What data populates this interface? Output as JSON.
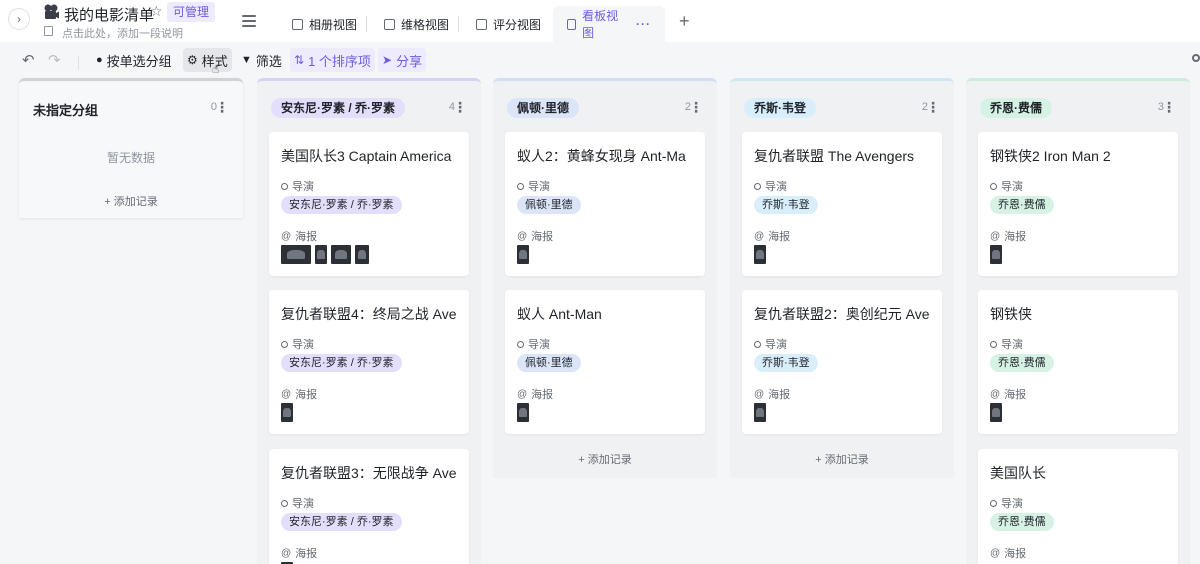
{
  "header": {
    "title": "我的电影清单",
    "permission": "可管理",
    "description_placeholder": "点击此处，添加一段说明"
  },
  "views": [
    {
      "label": "相册视图",
      "active": false
    },
    {
      "label": "维格视图",
      "active": false
    },
    {
      "label": "评分视图",
      "active": false
    },
    {
      "label": "看板视图",
      "active": true
    }
  ],
  "toolbar": {
    "group_by": "按单选分组",
    "style": "样式",
    "filter": "筛选",
    "sort": "1 个排序项",
    "share": "分享"
  },
  "board": {
    "field_director": "导演",
    "field_poster": "海报",
    "add_record": "+ 添加记录",
    "empty": "暂无数据",
    "columns": [
      {
        "name": "未指定分组",
        "count": "0",
        "color": "",
        "cards": []
      },
      {
        "name": "安东尼·罗素 / 乔·罗素",
        "count": "4",
        "color": "#e3defb",
        "accent": "#d6d1f5",
        "cards": [
          {
            "title": "美国队长3 Captain America",
            "director": "安东尼·罗素 / 乔·罗素",
            "posters": 4
          },
          {
            "title": "复仇者联盟4：终局之战 Ave",
            "director": "安东尼·罗素 / 乔·罗素",
            "posters": 1
          },
          {
            "title": "复仇者联盟3：无限战争 Ave",
            "director": "安东尼·罗素 / 乔·罗素",
            "posters": 1
          }
        ]
      },
      {
        "name": "佩顿·里德",
        "count": "2",
        "color": "#dbe5f7",
        "accent": "#d3ddf3",
        "cards": [
          {
            "title": "蚁人2：黄蜂女现身 Ant-Ma",
            "director": "佩顿·里德",
            "posters": 1
          },
          {
            "title": "蚁人 Ant-Man",
            "director": "佩顿·里德",
            "posters": 1
          }
        ]
      },
      {
        "name": "乔斯·韦登",
        "count": "2",
        "color": "#d8eefa",
        "accent": "#cfe6f3",
        "cards": [
          {
            "title": "复仇者联盟 The Avengers",
            "director": "乔斯·韦登",
            "posters": 1
          },
          {
            "title": "复仇者联盟2：奥创纪元 Ave",
            "director": "乔斯·韦登",
            "posters": 1
          }
        ]
      },
      {
        "name": "乔恩·费儒",
        "count": "3",
        "color": "#d6f2e4",
        "accent": "#cdecdc",
        "cards": [
          {
            "title": "钢铁侠2 Iron Man 2",
            "director": "乔恩·费儒",
            "posters": 1
          },
          {
            "title": "钢铁侠",
            "director": "乔恩·费儒",
            "posters": 1
          },
          {
            "title": "美国队长",
            "director": "乔恩·费儒",
            "posters": 0
          }
        ]
      }
    ]
  }
}
